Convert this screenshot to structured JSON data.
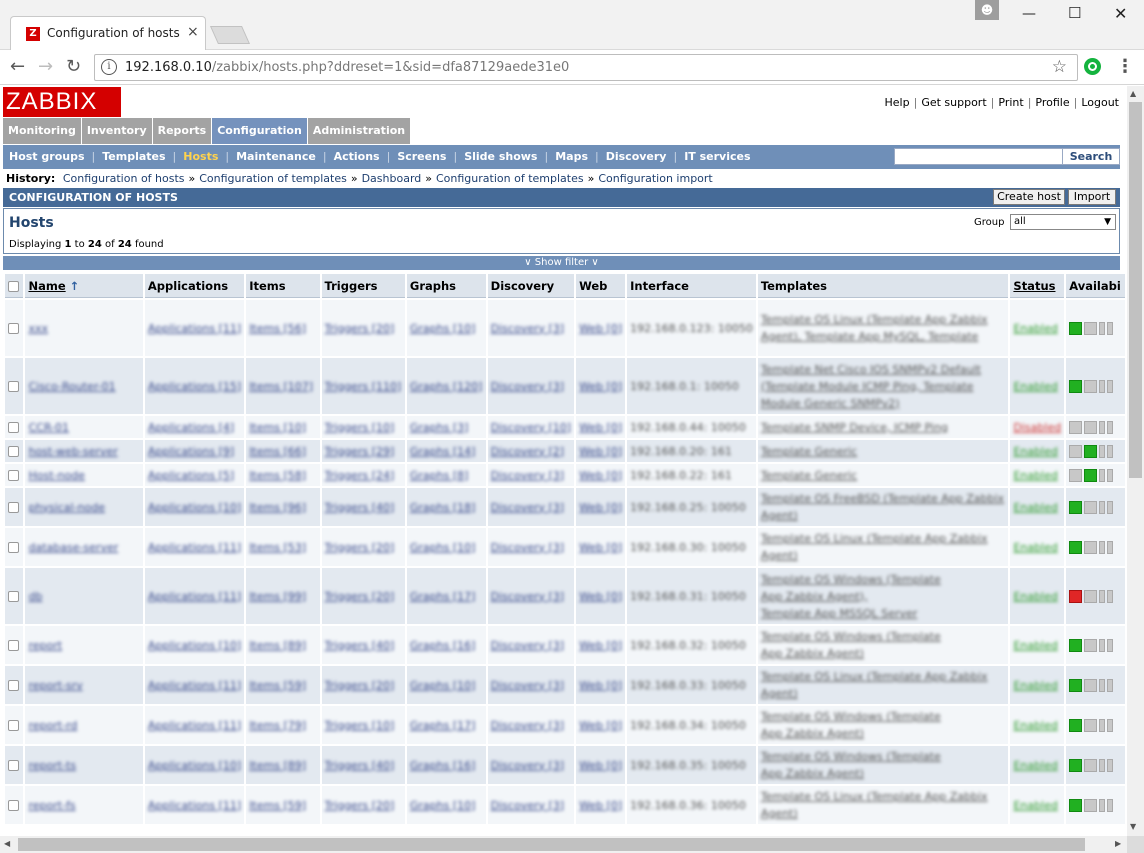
{
  "browser": {
    "tab_title": "Configuration of hosts",
    "tab_icon_letter": "Z",
    "tab_close": "×",
    "url": "192.168.0.10/zabbix/hosts.php?ddreset=1&sid=dfa87129aede31e0",
    "url_host": "192.168.0.10",
    "url_path": "/zabbix/hosts.php?ddreset=1&sid=dfa87129aede31e0"
  },
  "header": {
    "logo": "ZABBIX",
    "links": [
      "Help",
      "Get support",
      "Print",
      "Profile",
      "Logout"
    ]
  },
  "menu": {
    "items": [
      "Monitoring",
      "Inventory",
      "Reports",
      "Configuration",
      "Administration"
    ],
    "active": "Configuration"
  },
  "submenu": {
    "items": [
      "Host groups",
      "Templates",
      "Hosts",
      "Maintenance",
      "Actions",
      "Screens",
      "Slide shows",
      "Maps",
      "Discovery",
      "IT services"
    ],
    "active": "Hosts",
    "search_button": "Search"
  },
  "history": {
    "label": "History:",
    "items": [
      "Configuration of hosts",
      "Configuration of templates",
      "Dashboard",
      "Configuration of templates",
      "Configuration import"
    ]
  },
  "section": {
    "title": "CONFIGURATION OF HOSTS",
    "create_button": "Create host",
    "import_button": "Import"
  },
  "hosts_box": {
    "title": "Hosts",
    "displaying_prefix": "Displaying",
    "from": "1",
    "to_word": "to",
    "to": "24",
    "of_word": "of",
    "total": "24",
    "found_word": "found",
    "group_label": "Group",
    "group_value": "all"
  },
  "filter": {
    "label": "Show filter"
  },
  "table": {
    "columns": [
      "Name",
      "Applications",
      "Items",
      "Triggers",
      "Graphs",
      "Discovery",
      "Web",
      "Interface",
      "Templates",
      "Status",
      "Availabi"
    ],
    "rows": [
      {
        "name": "xxx",
        "apps": "Applications [11]",
        "items": "Items [56]",
        "triggers": "Triggers [20]",
        "graphs": "Graphs [10]",
        "discovery": "Discovery [3]",
        "web": "Web [0]",
        "iface": "192.168.0.123: 10050",
        "templates": [
          "Template OS Linux (Template App Zabbix",
          "Agent), Template App MySQL, Template"
        ],
        "status": "Enabled",
        "avail": "green"
      },
      {
        "name": "Cisco-Router-01",
        "apps": "Applications [15]",
        "items": "Items [107]",
        "triggers": "Triggers [110]",
        "graphs": "Graphs [120]",
        "discovery": "Discovery [3]",
        "web": "Web [0]",
        "iface": "192.168.0.1: 10050",
        "templates": [
          "Template Net Cisco IOS SNMPv2 Default",
          "(Template Module ICMP Ping, Template",
          "Module Generic SNMPv2)"
        ],
        "status": "Enabled",
        "avail": "green"
      },
      {
        "name": "CCR-01",
        "apps": "Applications [4]",
        "items": "Items [10]",
        "triggers": "Triggers [10]",
        "graphs": "Graphs [3]",
        "discovery": "Discovery [10]",
        "web": "Web [0]",
        "iface": "192.168.0.44: 10050",
        "templates": [
          "Template SNMP Device, ICMP Ping"
        ],
        "status": "Disabled",
        "avail": "grey"
      },
      {
        "name": "host-web-server",
        "apps": "Applications [9]",
        "items": "Items [66]",
        "triggers": "Triggers [29]",
        "graphs": "Graphs [14]",
        "discovery": "Discovery [2]",
        "web": "Web [0]",
        "iface": "192.168.0.20: 161",
        "templates": [
          "Template Generic"
        ],
        "status": "Enabled",
        "avail": "mixed"
      },
      {
        "name": "Host-node",
        "apps": "Applications [5]",
        "items": "Items [58]",
        "triggers": "Triggers [24]",
        "graphs": "Graphs [8]",
        "discovery": "Discovery [3]",
        "web": "Web [0]",
        "iface": "192.168.0.22: 161",
        "templates": [
          "Template Generic"
        ],
        "status": "Enabled",
        "avail": "mixed"
      },
      {
        "name": "physical-node",
        "apps": "Applications [10]",
        "items": "Items [96]",
        "triggers": "Triggers [40]",
        "graphs": "Graphs [18]",
        "discovery": "Discovery [3]",
        "web": "Web [0]",
        "iface": "192.168.0.25: 10050",
        "templates": [
          "Template OS FreeBSD (Template App Zabbix",
          "Agent)"
        ],
        "status": "Enabled",
        "avail": "green"
      },
      {
        "name": "database-server",
        "apps": "Applications [11]",
        "items": "Items [53]",
        "triggers": "Triggers [20]",
        "graphs": "Graphs [10]",
        "discovery": "Discovery [3]",
        "web": "Web [0]",
        "iface": "192.168.0.30: 10050",
        "templates": [
          "Template OS Linux (Template App Zabbix",
          "Agent)"
        ],
        "status": "Enabled",
        "avail": "green"
      },
      {
        "name": "db",
        "apps": "Applications [11]",
        "items": "Items [99]",
        "triggers": "Triggers [20]",
        "graphs": "Graphs [17]",
        "discovery": "Discovery [3]",
        "web": "Web [0]",
        "iface": "192.168.0.31: 10050",
        "templates": [
          "Template OS Windows (Template",
          "App Zabbix Agent),",
          "Template App MSSQL Server"
        ],
        "status": "Enabled",
        "avail": "red"
      },
      {
        "name": "report",
        "apps": "Applications [10]",
        "items": "Items [89]",
        "triggers": "Triggers [40]",
        "graphs": "Graphs [16]",
        "discovery": "Discovery [3]",
        "web": "Web [0]",
        "iface": "192.168.0.32: 10050",
        "templates": [
          "Template OS Windows (Template",
          "App Zabbix Agent)"
        ],
        "status": "Enabled",
        "avail": "green"
      },
      {
        "name": "report-srv",
        "apps": "Applications [11]",
        "items": "Items [59]",
        "triggers": "Triggers [20]",
        "graphs": "Graphs [10]",
        "discovery": "Discovery [3]",
        "web": "Web [0]",
        "iface": "192.168.0.33: 10050",
        "templates": [
          "Template OS Linux (Template App Zabbix",
          "Agent)"
        ],
        "status": "Enabled",
        "avail": "green"
      },
      {
        "name": "report-rd",
        "apps": "Applications [11]",
        "items": "Items [79]",
        "triggers": "Triggers [10]",
        "graphs": "Graphs [17]",
        "discovery": "Discovery [3]",
        "web": "Web [0]",
        "iface": "192.168.0.34: 10050",
        "templates": [
          "Template OS Windows (Template",
          "App Zabbix Agent)"
        ],
        "status": "Enabled",
        "avail": "green"
      },
      {
        "name": "report-ts",
        "apps": "Applications [10]",
        "items": "Items [89]",
        "triggers": "Triggers [40]",
        "graphs": "Graphs [16]",
        "discovery": "Discovery [3]",
        "web": "Web [0]",
        "iface": "192.168.0.35: 10050",
        "templates": [
          "Template OS Windows (Template",
          "App Zabbix Agent)"
        ],
        "status": "Enabled",
        "avail": "green"
      },
      {
        "name": "report-fs",
        "apps": "Applications [11]",
        "items": "Items [59]",
        "triggers": "Triggers [20]",
        "graphs": "Graphs [10]",
        "discovery": "Discovery [3]",
        "web": "Web [0]",
        "iface": "192.168.0.36: 10050",
        "templates": [
          "Template OS Linux (Template App Zabbix",
          "Agent)"
        ],
        "status": "Enabled",
        "avail": "green"
      }
    ]
  }
}
